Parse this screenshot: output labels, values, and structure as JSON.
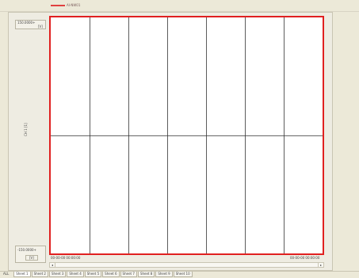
{
  "legend": {
    "label": "AI-NW01",
    "swatch_color": "#e04040"
  },
  "y_axis": {
    "max_label": "150.0000+",
    "max_unit": "[V]",
    "min_label": "-150.0000+",
    "min_unit": "[V]",
    "title": "CH 1 [1]"
  },
  "x_axis": {
    "start_label": "00-00-00 00:00:00",
    "end_label": "00-00-00 00:00:00"
  },
  "plot": {
    "border_color": "#e02020",
    "grid_color": "#333333",
    "columns": 7,
    "rows": 2
  },
  "scrollbar": {
    "left_glyph": "◂",
    "right_glyph": "▸"
  },
  "tabs": [
    {
      "label": "ALL"
    },
    {
      "label": "Sheet 1"
    },
    {
      "label": "Sheet 2"
    },
    {
      "label": "Sheet 3"
    },
    {
      "label": "Sheet 4"
    },
    {
      "label": "Sheet 5"
    },
    {
      "label": "Sheet 6"
    },
    {
      "label": "Sheet 7"
    },
    {
      "label": "Sheet 8"
    },
    {
      "label": "Sheet 9"
    },
    {
      "label": "Sheet 10"
    }
  ]
}
